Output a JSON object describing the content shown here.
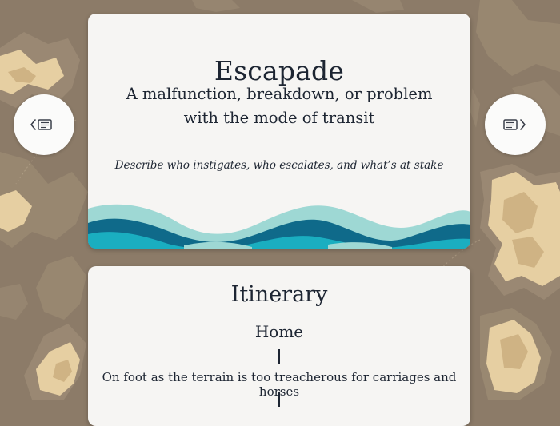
{
  "card": {
    "title": "Escapade",
    "subtitle": "A malfunction, breakdown, or problem with the mode of transit",
    "prompt": "Describe who instigates, who escalates, and what’s at stake"
  },
  "itinerary": {
    "title": "Itinerary",
    "start": "Home",
    "leg": "On foot as the terrain is too treacherous for carriages and horses"
  },
  "nav": {
    "prev_icon": "chevron-left-card-icon",
    "next_icon": "card-chevron-right-icon"
  },
  "colors": {
    "background": "#8c7b68",
    "land": "#e6cfa2",
    "card": "#f6f5f3",
    "text": "#1d2532",
    "wave_light": "#9ed8d4",
    "wave_dark": "#0f6a8a",
    "wave_mid": "#1aaec0"
  }
}
